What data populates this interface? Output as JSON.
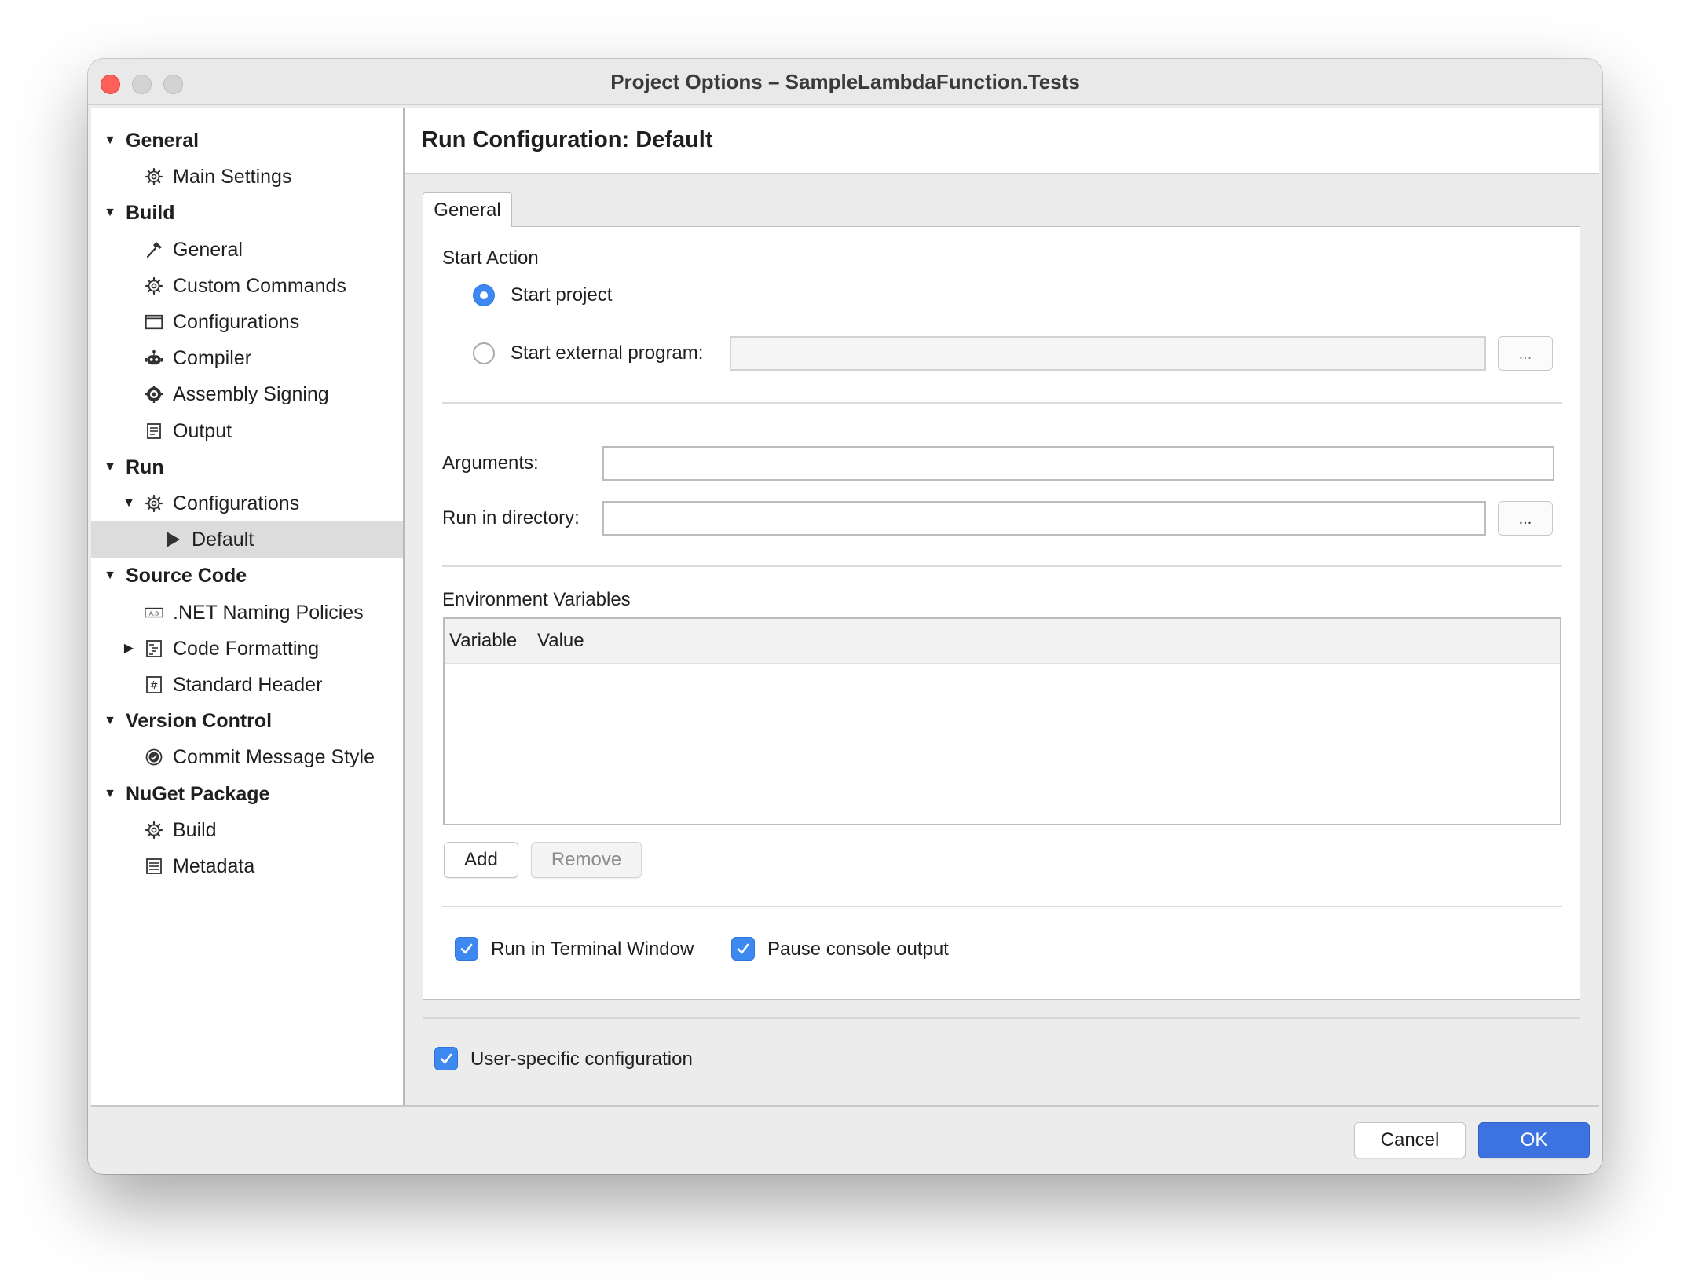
{
  "window": {
    "title": "Project Options – SampleLambdaFunction.Tests"
  },
  "sidebar": {
    "items": [
      {
        "label": "General",
        "type": "header",
        "expanded": true,
        "icon": ""
      },
      {
        "label": "Main Settings",
        "type": "item",
        "icon": "gear-icon"
      },
      {
        "label": "Build",
        "type": "header",
        "expanded": true,
        "icon": ""
      },
      {
        "label": "General",
        "type": "item",
        "icon": "hammer-icon"
      },
      {
        "label": "Custom Commands",
        "type": "item",
        "icon": "gear-icon"
      },
      {
        "label": "Configurations",
        "type": "item",
        "icon": "window-icon"
      },
      {
        "label": "Compiler",
        "type": "item",
        "icon": "robot-icon"
      },
      {
        "label": "Assembly Signing",
        "type": "item",
        "icon": "seal-icon"
      },
      {
        "label": "Output",
        "type": "item",
        "icon": "document-icon"
      },
      {
        "label": "Run",
        "type": "header",
        "expanded": true,
        "icon": ""
      },
      {
        "label": "Configurations",
        "type": "subheader",
        "expanded": true,
        "icon": "gear-icon"
      },
      {
        "label": "Default",
        "type": "leaf",
        "icon": "play-icon",
        "selected": true
      },
      {
        "label": "Source Code",
        "type": "header",
        "expanded": true,
        "icon": ""
      },
      {
        "label": ".NET Naming Policies",
        "type": "item",
        "icon": "naming-icon"
      },
      {
        "label": "Code Formatting",
        "type": "item",
        "icon": "code-format-icon",
        "collapsed": true
      },
      {
        "label": "Standard Header",
        "type": "item",
        "icon": "hash-icon"
      },
      {
        "label": "Version Control",
        "type": "header",
        "expanded": true,
        "icon": ""
      },
      {
        "label": "Commit Message Style",
        "type": "item",
        "icon": "check-circle-icon"
      },
      {
        "label": "NuGet Package",
        "type": "header",
        "expanded": true,
        "icon": ""
      },
      {
        "label": "Build",
        "type": "item",
        "icon": "gear-icon"
      },
      {
        "label": "Metadata",
        "type": "item",
        "icon": "list-icon"
      }
    ]
  },
  "main": {
    "title": "Run Configuration: Default",
    "tab": "General",
    "start_action": {
      "label": "Start Action",
      "start_project": "Start project",
      "start_external": "Start external program:",
      "external_value": "",
      "browse": "..."
    },
    "arguments": {
      "label": "Arguments:",
      "value": ""
    },
    "run_dir": {
      "label": "Run in directory:",
      "value": "",
      "browse": "..."
    },
    "env": {
      "label": "Environment Variables",
      "col_variable": "Variable",
      "col_value": "Value",
      "add": "Add",
      "remove": "Remove"
    },
    "run_in_terminal": "Run in Terminal Window",
    "pause_console": "Pause console output",
    "user_specific": "User-specific configuration"
  },
  "footer": {
    "cancel": "Cancel",
    "ok": "OK"
  },
  "colors": {
    "accent": "#3e88f2",
    "primary_button": "#3d73e0",
    "close": "#fe5f57"
  }
}
